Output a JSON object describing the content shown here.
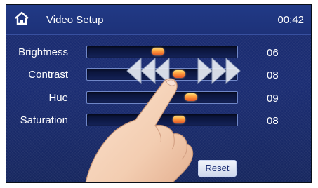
{
  "header": {
    "title": "Video Setup",
    "clock": "00:42",
    "home_icon": "home-icon"
  },
  "settings": [
    {
      "label": "Brightness",
      "value": "06",
      "level": 0.47
    },
    {
      "label": "Contrast",
      "value": "08",
      "level": 0.62
    },
    {
      "label": "Hue",
      "value": "09",
      "level": 0.71
    },
    {
      "label": "Saturation",
      "value": "08",
      "level": 0.62
    }
  ],
  "reset_label": "Reset",
  "overlay": {
    "gesture_icon": "swipe-arrows-icon",
    "hand_icon": "pointing-hand-icon"
  },
  "colors": {
    "background": "#1b2d73",
    "knob": "#ff9a3a",
    "text": "#ffffff"
  }
}
